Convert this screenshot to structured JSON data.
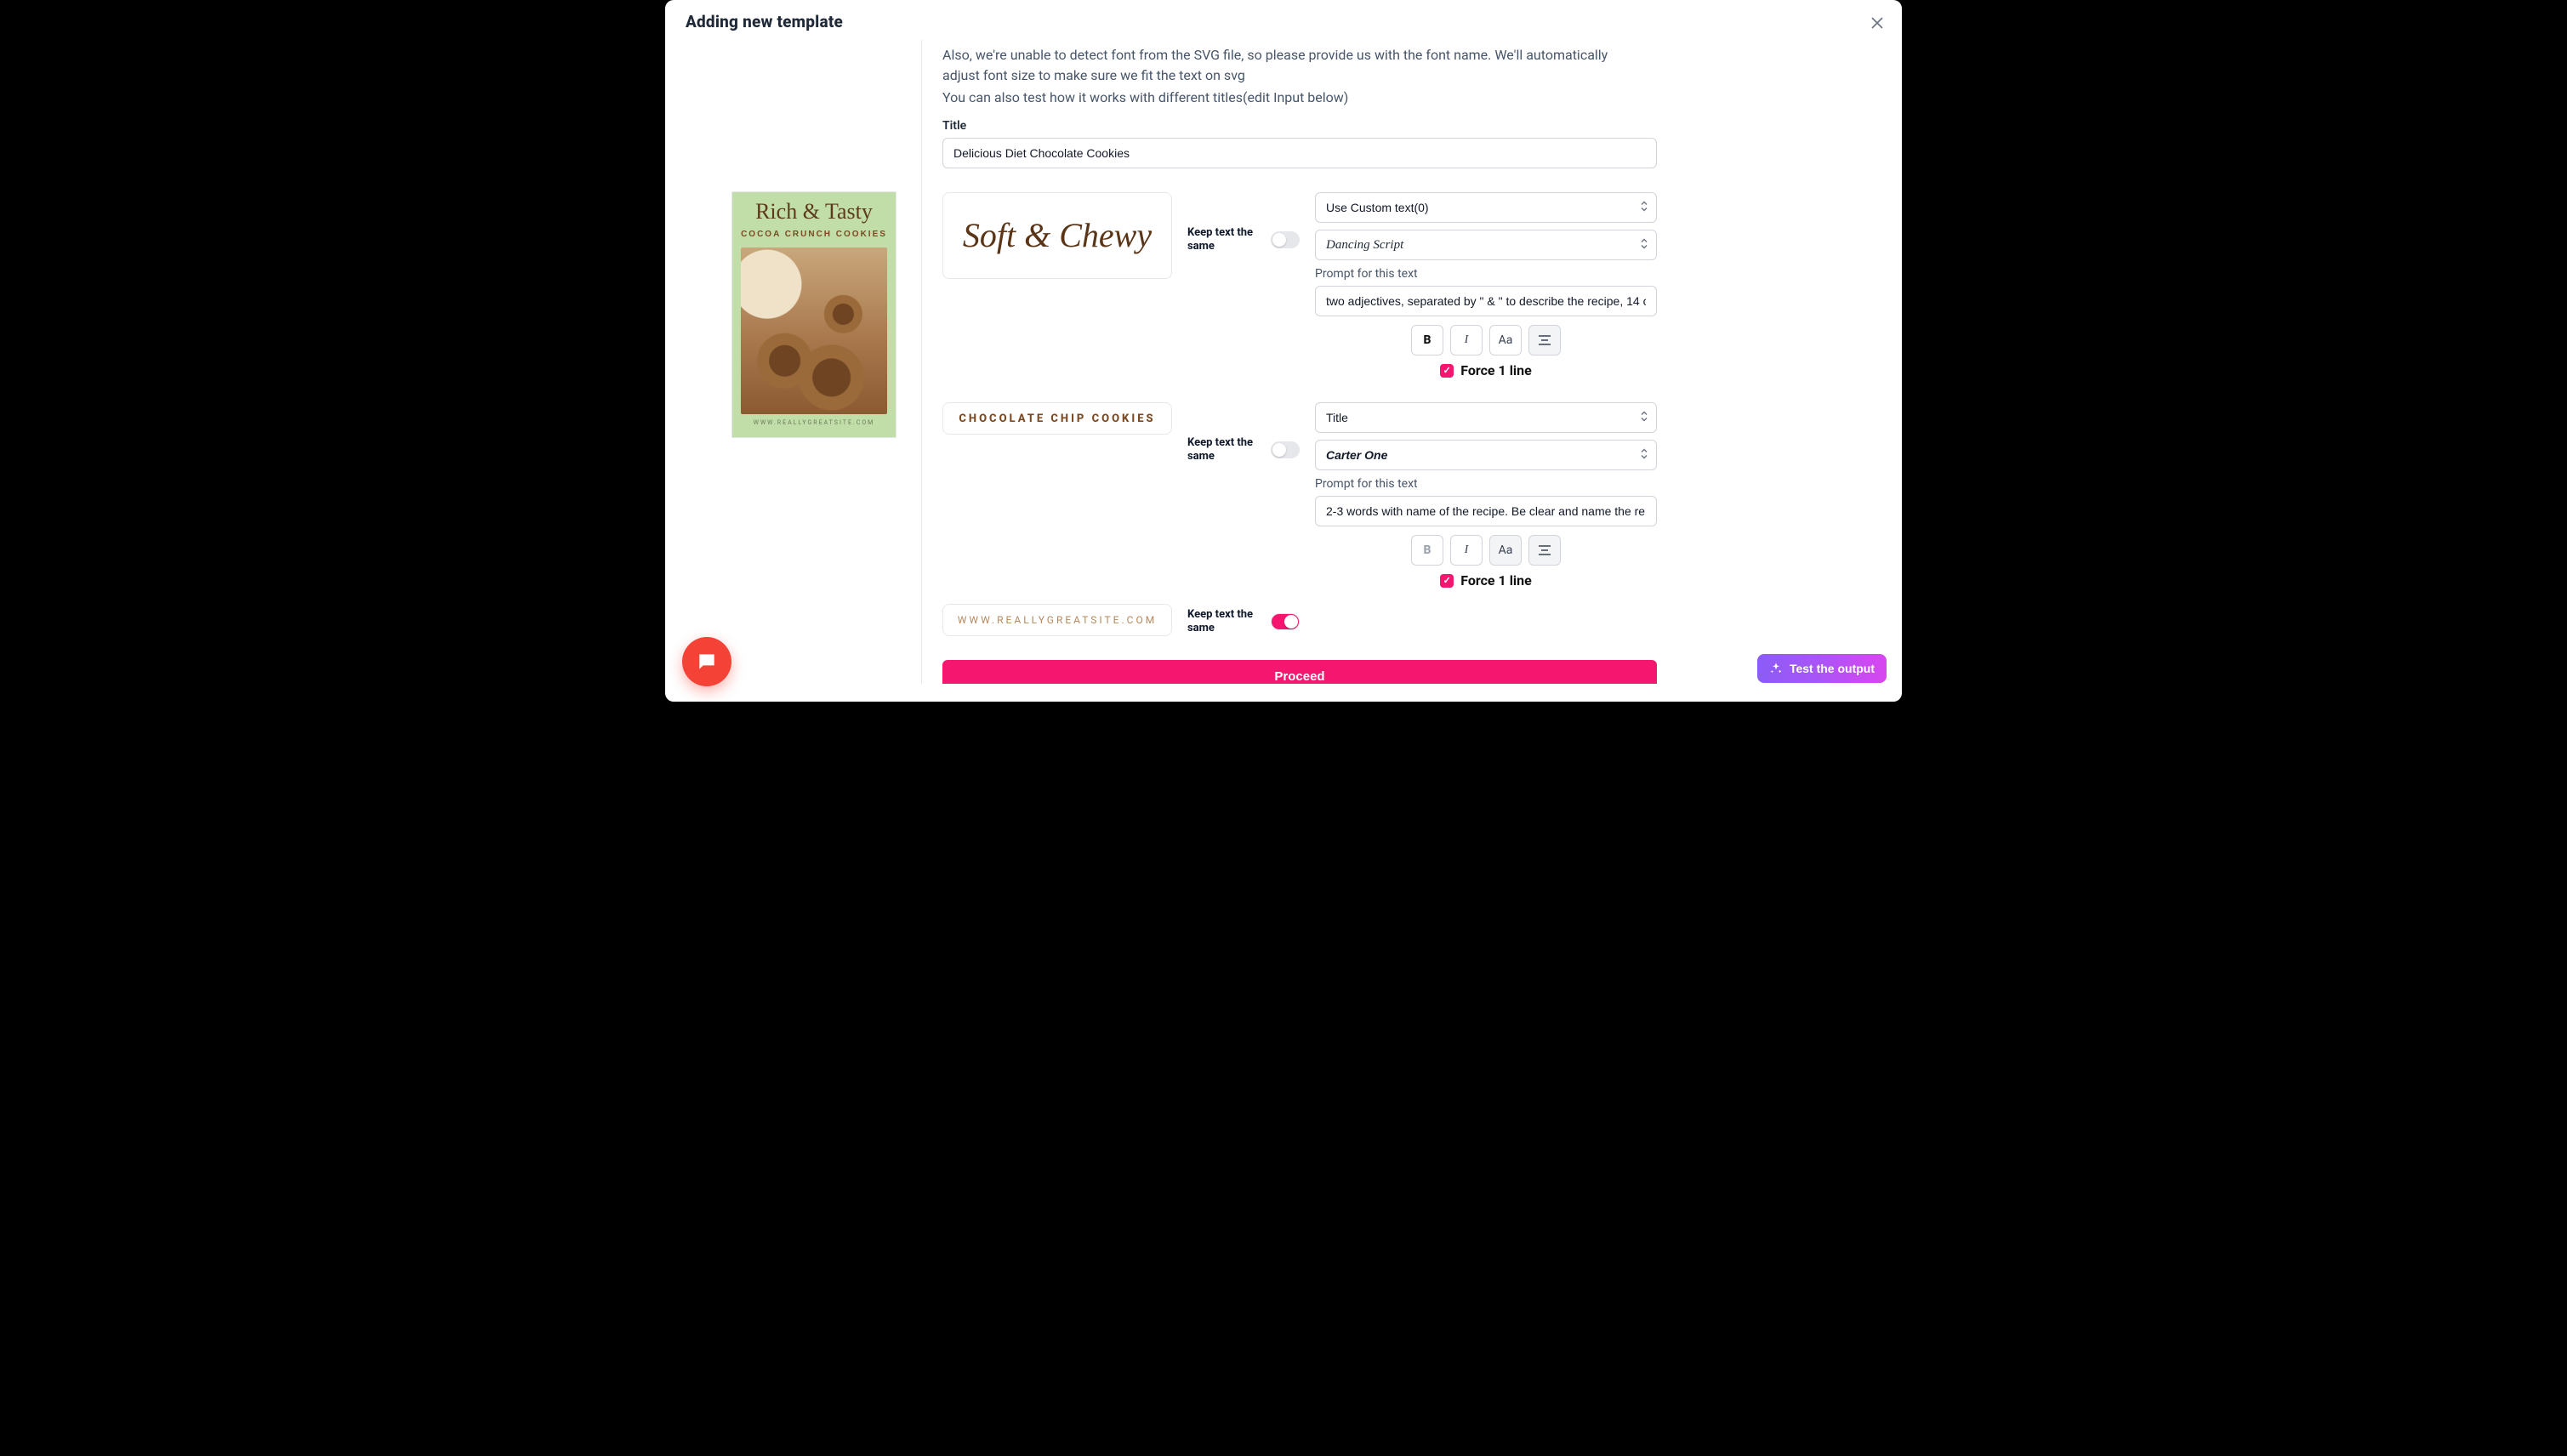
{
  "header": {
    "title": "Adding new template"
  },
  "intro": {
    "p1": "Also, we're unable to detect font from the SVG file, so please provide us with the font name. We'll automatically adjust font size to make sure we fit the text on svg",
    "p2": "You can also test how it works with different titles(edit Input below)"
  },
  "title_field": {
    "label": "Title",
    "value": "Delicious Diet Chocolate Cookies"
  },
  "poster": {
    "headline": "Rich & Tasty",
    "sub": "COCOA CRUNCH COOKIES",
    "url": "WWW.REALLYGREATSITE.COM"
  },
  "blocks": [
    {
      "sample": "Soft & Chewy",
      "keep_label": "Keep text the same",
      "keep_on": false,
      "source_select": "Use Custom text(0)",
      "font_select": "Dancing Script",
      "prompt_label": "Prompt for this text",
      "prompt_value": "two adjectives, separated by \" & \" to describe the recipe, 14 c",
      "fmt": {
        "bold": true,
        "italic": false,
        "case": false,
        "align": true
      },
      "force_label": "Force 1 line",
      "force_checked": true
    },
    {
      "sample": "CHOCOLATE CHIP COOKIES",
      "keep_label": "Keep text the same",
      "keep_on": false,
      "source_select": "Title",
      "font_select": "Carter One",
      "prompt_label": "Prompt for this text",
      "prompt_value": "2-3 words with name of the recipe. Be clear and name the re",
      "fmt": {
        "bold": false,
        "italic": false,
        "case": true,
        "align": true
      },
      "force_label": "Force 1 line",
      "force_checked": true
    },
    {
      "sample": "WWW.REALLYGREATSITE.COM",
      "keep_label": "Keep text the same",
      "keep_on": true
    }
  ],
  "cta": {
    "proceed": "Proceed",
    "test": "Test the output"
  }
}
